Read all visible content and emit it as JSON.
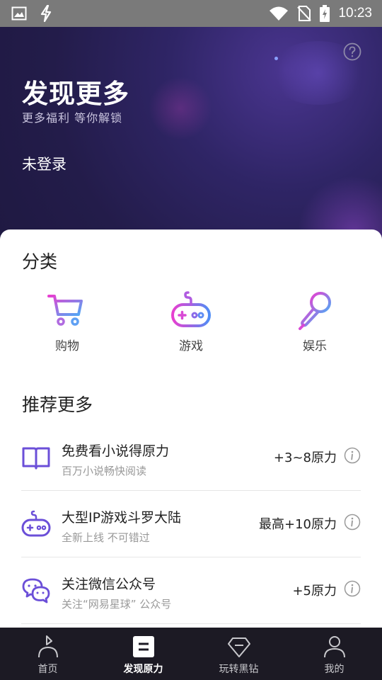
{
  "status_bar": {
    "time": "10:23",
    "icons": [
      "image-icon",
      "lightning-icon",
      "wifi-icon",
      "no-sim-icon",
      "battery-charging-icon"
    ]
  },
  "hero": {
    "title": "发现更多",
    "subtitle": "更多福利 等你解锁",
    "login_status": "未登录",
    "help_icon": "question-circle-icon"
  },
  "categories": {
    "title": "分类",
    "items": [
      {
        "label": "购物",
        "icon": "shopping-cart-icon"
      },
      {
        "label": "游戏",
        "icon": "gamepad-icon"
      },
      {
        "label": "娱乐",
        "icon": "microphone-icon"
      }
    ]
  },
  "recommend": {
    "title": "推荐更多",
    "items": [
      {
        "title": "免费看小说得原力",
        "subtitle": "百万小说畅快阅读",
        "reward": "+3~8原力",
        "icon": "book-icon"
      },
      {
        "title": "大型IP游戏斗罗大陆",
        "subtitle": "全新上线 不可错过",
        "reward": "最高+10原力",
        "icon": "gamepad-icon"
      },
      {
        "title": "关注微信公众号",
        "subtitle": "关注“网易星球” 公众号",
        "reward": "+5原力",
        "icon": "wechat-icon"
      }
    ]
  },
  "bottom_nav": {
    "items": [
      {
        "label": "首页",
        "icon": "home-planet-icon",
        "active": false
      },
      {
        "label": "发现原力",
        "icon": "discover-icon",
        "active": true
      },
      {
        "label": "玩转黑钻",
        "icon": "diamond-icon",
        "active": false
      },
      {
        "label": "我的",
        "icon": "profile-icon",
        "active": false
      }
    ]
  },
  "colors": {
    "accent_purple": "#6b4fd8",
    "gradient_pink": "#e83fd0",
    "gradient_blue": "#4fa9f5",
    "hero_bg": "#231c4a",
    "nav_bg": "#1c1a24"
  }
}
